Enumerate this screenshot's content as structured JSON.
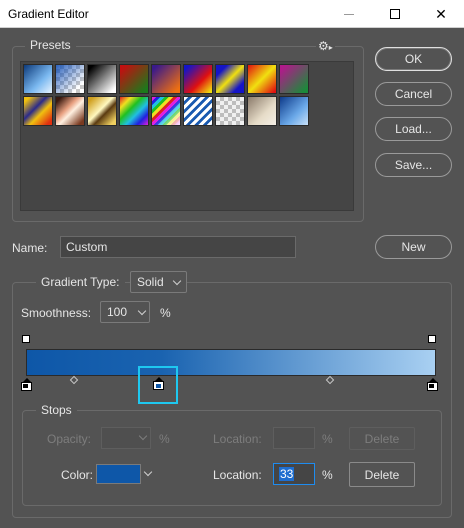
{
  "window": {
    "title": "Gradient Editor",
    "minimize_icon": "minimize-icon",
    "maximize_icon": "maximize-icon",
    "close_icon": "close-icon",
    "close_glyph": "✕"
  },
  "presets": {
    "label": "Presets",
    "menu_icon": "gear-icon",
    "menu_glyph": "⚙",
    "swatches_row1": [
      "linear-gradient(135deg,#0d3a7a,#7ab8f0 60%,#e9f4ff)",
      "checker-blue",
      "linear-gradient(135deg,#000 10%,#fff 90%)",
      "linear-gradient(135deg,#c01010 10%,#1b7a1b 90%)",
      "linear-gradient(135deg,#3a1a8a 10%,#f07010 90%)",
      "linear-gradient(135deg,#1414c8 10%,#e01010 60%,#f0e010 95%)",
      "linear-gradient(135deg,#1414c8 20%,#f0e010 50%,#1414c8 80%)",
      "linear-gradient(135deg,#e01010,#f0e010 50%,#e01010 95%)",
      "linear-gradient(135deg,#b01a8a 10%,#1b8a3a 90%)"
    ],
    "swatches_row2": [
      "linear-gradient(135deg,#f0c010 10%,#2a2a8a 40%,#f0c010 60%,#e03010 90%)",
      "linear-gradient(135deg,#3a1a10 10%,#e8a080 40%,#fff0e0 55%,#7a3a20 90%)",
      "linear-gradient(135deg,#d0a020 10%,#fff8c0 45%,#5a3a10 60%,#f0d060 90%)",
      "linear-gradient(135deg,#e02020,#f0e020 20%,#20c020 40%,#20c0e0 60%,#2020e0 80%,#e020e0)",
      "rainbow-stripes",
      "stripes-blue",
      "checker-gray",
      "linear-gradient(135deg,#8a7a6a,#e6dcc8 60%,#f4efe6)",
      "linear-gradient(135deg,#0d3a8a,#6aa8e8 60%,#c8e0f8)"
    ]
  },
  "buttons": {
    "ok": "OK",
    "cancel": "Cancel",
    "load": "Load...",
    "save": "Save...",
    "new": "New"
  },
  "name": {
    "label": "Name:",
    "value": "Custom"
  },
  "gradient_type": {
    "label": "Gradient Type:",
    "value": "Solid"
  },
  "smoothness": {
    "label": "Smoothness:",
    "value": "100",
    "unit": "%"
  },
  "gradient": {
    "colors": [
      "#0e57a8",
      "#1a63b0",
      "#a9d0f2"
    ],
    "stop_color": "#0e57a8",
    "selection_color": "#1ec8f0"
  },
  "stops": {
    "label": "Stops",
    "opacity_label": "Opacity:",
    "opacity_value": "",
    "opacity_unit": "%",
    "opacity_location_label": "Location:",
    "opacity_location_value": "",
    "opacity_location_unit": "%",
    "opacity_delete": "Delete",
    "color_label": "Color:",
    "color_value": "#0e57a8",
    "color_location_label": "Location:",
    "color_location_value": "33",
    "color_location_unit": "%",
    "color_delete": "Delete"
  }
}
